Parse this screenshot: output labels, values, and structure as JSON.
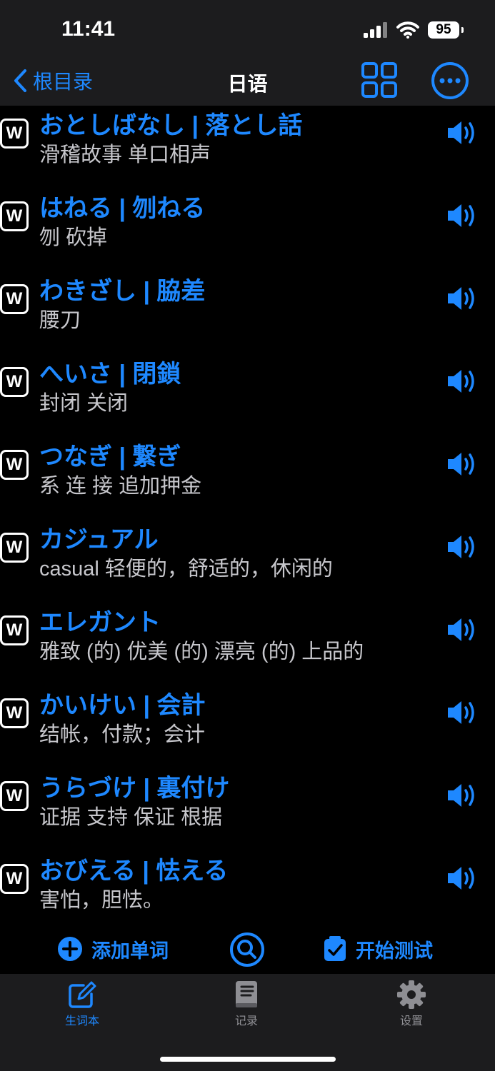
{
  "status_bar": {
    "time": "11:41",
    "battery": "95"
  },
  "nav": {
    "back_label": "根目录",
    "title": "日语",
    "grid_icon": "grid-icon",
    "more_icon": "more-icon"
  },
  "words": [
    {
      "word": "おとしばなし | 落とし話",
      "meaning": "滑稽故事 单口相声"
    },
    {
      "word": "はねる | 刎ねる",
      "meaning": "刎 砍掉"
    },
    {
      "word": "わきざし | 脇差",
      "meaning": "腰刀"
    },
    {
      "word": "へいさ | 閉鎖",
      "meaning": "封闭 关闭"
    },
    {
      "word": "つなぎ | 繋ぎ",
      "meaning": "系 连 接 追加押金"
    },
    {
      "word": "カジュアル",
      "meaning": "casual 轻便的，舒适的，休闲的"
    },
    {
      "word": "エレガント",
      "meaning": "雅致 (的) 优美 (的) 漂亮 (的) 上品的"
    },
    {
      "word": "かいけい | 会計",
      "meaning": "结帐，付款；会计"
    },
    {
      "word": "うらづけ | 裏付け",
      "meaning": "证据 支持 保证 根据"
    },
    {
      "word": "おびえる | 怯える",
      "meaning": "害怕，胆怯。"
    }
  ],
  "badge_letter": "W",
  "actions": {
    "add_label": "添加单词",
    "test_label": "开始测试"
  },
  "tabs": [
    {
      "label": "生词本",
      "icon": "edit-icon",
      "active": true
    },
    {
      "label": "记录",
      "icon": "book-icon",
      "active": false
    },
    {
      "label": "设置",
      "icon": "gear-icon",
      "active": false
    }
  ],
  "colors": {
    "accent": "#1e88ff",
    "background": "#000000",
    "bar": "#1c1c1e",
    "inactive": "#8e8e93"
  }
}
